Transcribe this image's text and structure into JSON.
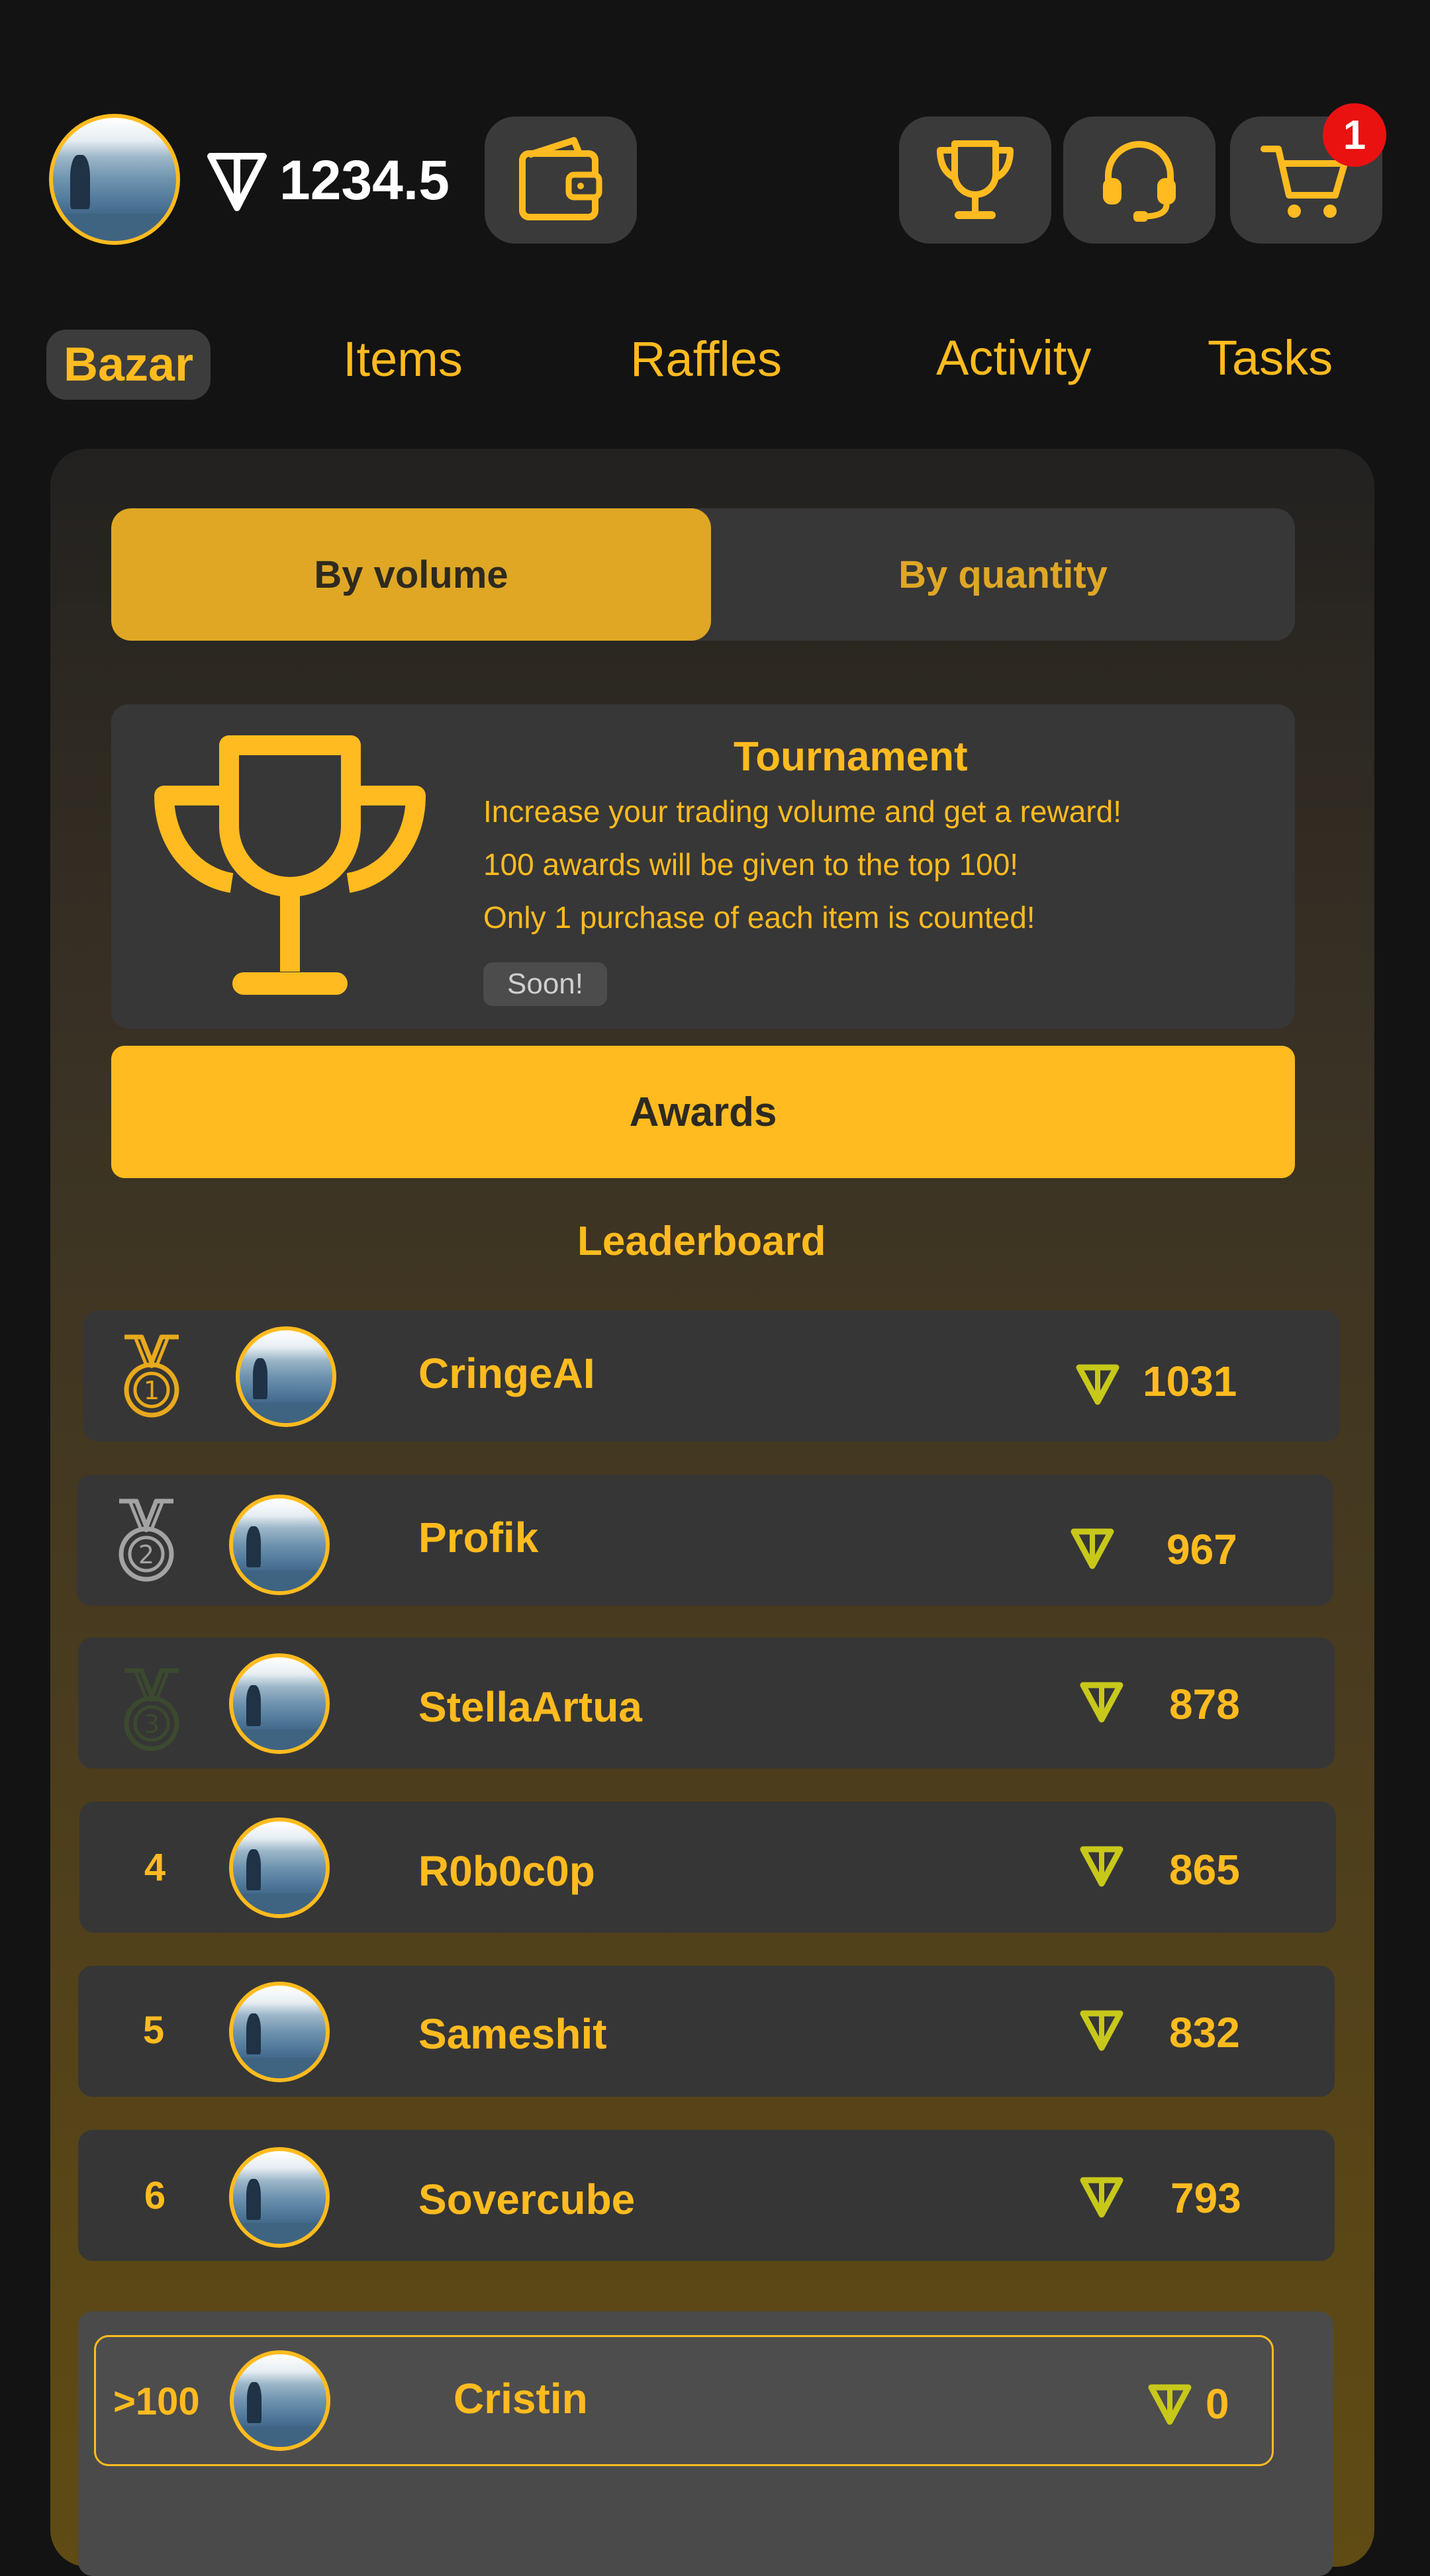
{
  "header": {
    "balance": "1234.5",
    "cart_count": "1"
  },
  "nav": {
    "tabs": [
      {
        "label": "Bazar",
        "active": true
      },
      {
        "label": "Items",
        "active": false
      },
      {
        "label": "Raffles",
        "active": false
      },
      {
        "label": "Activity",
        "active": false
      },
      {
        "label": "Tasks",
        "active": false
      }
    ]
  },
  "toggle": {
    "by_volume": "By volume",
    "by_quantity": "By quantity",
    "selected": "By volume"
  },
  "tournament": {
    "title": "Tournament",
    "lines": [
      "Increase your trading volume and get a reward!",
      "100 awards will be given to the top 100!",
      "Only 1 purchase of each item is counted!"
    ],
    "badge": "Soon!"
  },
  "awards_button": "Awards",
  "leaderboard": {
    "title": "Leaderboard",
    "rows": [
      {
        "rank": "1",
        "name": "CringeAI",
        "amount": "1031",
        "medal": "gold"
      },
      {
        "rank": "2",
        "name": "Profik",
        "amount": "967",
        "medal": "silver"
      },
      {
        "rank": "3",
        "name": "StellaArtua",
        "amount": "878",
        "medal": "bronze"
      },
      {
        "rank": "4",
        "name": "R0b0c0p",
        "amount": "865"
      },
      {
        "rank": "5",
        "name": "Sameshit",
        "amount": "832"
      },
      {
        "rank": "6",
        "name": "Sovercube",
        "amount": "793"
      }
    ],
    "me": {
      "rank": ">100",
      "name": "Cristin",
      "amount": "0"
    }
  },
  "colors": {
    "accent": "#ffbb1f",
    "coin": "#c8c81a",
    "background": "#131313",
    "card": "#363636",
    "badge": "#ea1111"
  },
  "icons": [
    "ton-icon",
    "wallet-icon",
    "trophy-icon",
    "headset-icon",
    "cart-icon",
    "medal-icon"
  ]
}
